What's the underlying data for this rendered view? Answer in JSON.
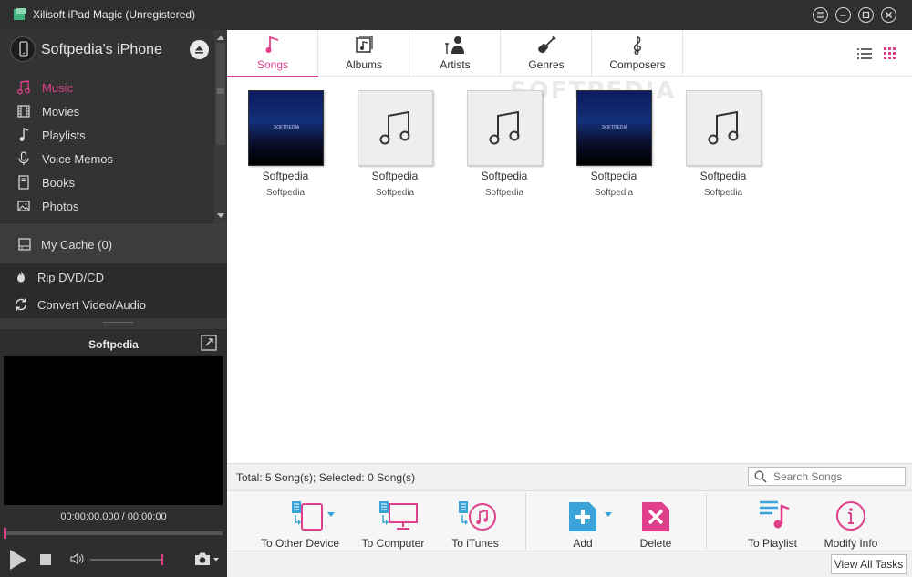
{
  "window": {
    "title": "Xilisoft iPad Magic (Unregistered)",
    "controls": [
      "menu-icon",
      "minimize-icon",
      "maximize-icon",
      "close-icon"
    ]
  },
  "sidebar": {
    "device_name": "Softpedia's iPhone",
    "items": [
      {
        "label": "Music",
        "icon": "music-note-icon",
        "active": true
      },
      {
        "label": "Movies",
        "icon": "film-icon",
        "active": false
      },
      {
        "label": "Playlists",
        "icon": "playlist-icon",
        "active": false
      },
      {
        "label": "Voice Memos",
        "icon": "microphone-icon",
        "active": false
      },
      {
        "label": "Books",
        "icon": "book-icon",
        "active": false
      },
      {
        "label": "Photos",
        "icon": "photo-icon",
        "active": false
      }
    ],
    "cache_label": "My Cache (0)",
    "tools": [
      {
        "label": "Rip DVD/CD",
        "icon": "flame-icon"
      },
      {
        "label": "Convert Video/Audio",
        "icon": "convert-icon"
      }
    ]
  },
  "player": {
    "title": "Softpedia",
    "time": "00:00:00.000 / 00:00:00",
    "progress": 0.0,
    "volume": 1.0
  },
  "tabs": [
    {
      "label": "Songs",
      "icon": "music-note-icon",
      "active": true
    },
    {
      "label": "Albums",
      "icon": "album-icon",
      "active": false
    },
    {
      "label": "Artists",
      "icon": "artist-icon",
      "active": false
    },
    {
      "label": "Genres",
      "icon": "guitar-icon",
      "active": false
    },
    {
      "label": "Composers",
      "icon": "treble-clef-icon",
      "active": false
    }
  ],
  "watermark": "SOFTPEDIA",
  "songs": [
    {
      "title": "Softpedia",
      "artist": "Softpedia",
      "cover": "art",
      "cover_text": "SOFTPEDIA"
    },
    {
      "title": "Softpedia",
      "artist": "Softpedia",
      "cover": "placeholder",
      "cover_text": ""
    },
    {
      "title": "Softpedia",
      "artist": "Softpedia",
      "cover": "placeholder",
      "cover_text": ""
    },
    {
      "title": "Softpedia",
      "artist": "Softpedia",
      "cover": "art",
      "cover_text": "SOFTPEDIA"
    },
    {
      "title": "Softpedia",
      "artist": "Softpedia",
      "cover": "placeholder",
      "cover_text": ""
    }
  ],
  "status": {
    "summary": "Total: 5 Song(s); Selected: 0 Song(s)",
    "search_placeholder": "Search Songs"
  },
  "toolbar": {
    "to_other_device": "To Other Device",
    "to_computer": "To Computer",
    "to_itunes": "To iTunes",
    "add": "Add",
    "delete": "Delete",
    "to_playlist": "To Playlist",
    "modify_info": "Modify Info"
  },
  "footer": {
    "view_all_tasks": "View All Tasks"
  },
  "colors": {
    "accent": "#e0408b",
    "blue": "#3aa4d8",
    "sidebar_bg": "#333333"
  }
}
